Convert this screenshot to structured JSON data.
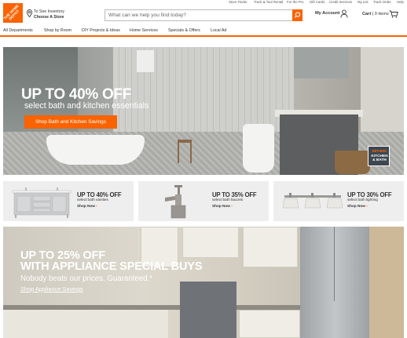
{
  "utility_nav": [
    "Store Finder",
    "Truck & Tool Rental",
    "For the Pro",
    "Gift Cards",
    "Credit Services",
    "My List",
    "Track Order",
    "Help"
  ],
  "logo": {
    "text": "THE HOME DEPOT",
    "color": "#f96302"
  },
  "store": {
    "line1": "To See Inventory",
    "line2": "Choose A Store",
    "icon": "map-pin-icon"
  },
  "search": {
    "placeholder": "What can we help you find today?",
    "value": "",
    "icon": "search-icon"
  },
  "account": {
    "label": "My Account",
    "icon": "user-icon"
  },
  "cart": {
    "label": "Cart",
    "count_text": "0 items",
    "icon": "cart-icon"
  },
  "dept_nav": [
    "All Departments",
    "Shop by Room",
    "DIY Projects & Ideas",
    "Home Services",
    "Specials & Offers",
    "Local Ad"
  ],
  "hero": {
    "headline": "UP TO 40% OFF",
    "subhead": "select bath and kitchen essentials",
    "cta": "Shop Bath and Kitchen Savings",
    "badge_line1": "RETHINK",
    "badge_line2": "KITCHEN & BATH"
  },
  "tiles": [
    {
      "title": "UP TO 40% OFF",
      "sub": "select bath vanities",
      "link": "Shop Now",
      "icon": "vanity-icon"
    },
    {
      "title": "UP TO 35% OFF",
      "sub": "select bath faucets",
      "link": "Shop Now",
      "icon": "faucet-icon"
    },
    {
      "title": "UP TO 30% OFF",
      "sub": "select bath lighting",
      "link": "Shop Now",
      "icon": "vanity-light-icon"
    }
  ],
  "kitchen": {
    "headline1": "UP TO 25% OFF",
    "headline2": "WITH APPLIANCE SPECIAL BUYS",
    "subhead": "Nobody beats our prices. Guaranteed.*",
    "link": "Shop Appliance Savings"
  },
  "colors": {
    "brand_orange": "#f96302",
    "text_dark": "#333333",
    "tile_bg": "#eeeeee"
  }
}
